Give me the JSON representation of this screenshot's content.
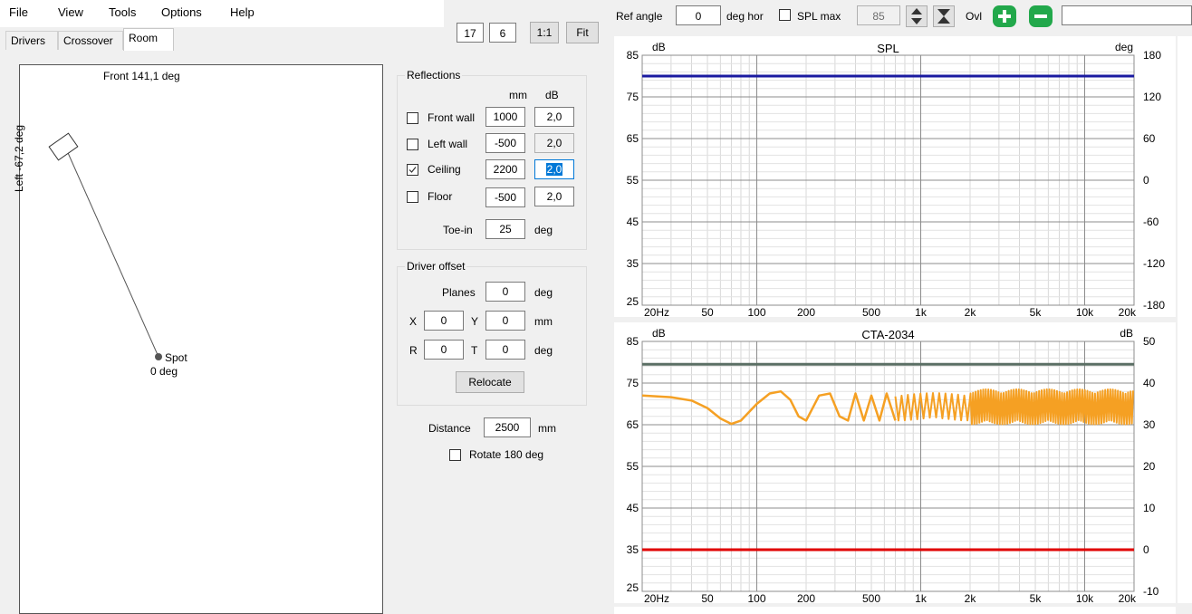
{
  "menu": [
    "File",
    "View",
    "Tools",
    "Options",
    "Help"
  ],
  "tabs": [
    "Drivers",
    "Crossover",
    "Room"
  ],
  "toolbar_left": {
    "n1": "17",
    "n2": "6",
    "one_to_one": "1:1",
    "fit": "Fit"
  },
  "toolbar_right": {
    "ref_angle_label": "Ref angle",
    "ref_angle_value": "0",
    "deg_hor_label": "deg hor",
    "spl_max_label": "SPL max",
    "spl_max_value": "85",
    "ovl_label": "Ovl",
    "ovl_value": ""
  },
  "room": {
    "front_label": "Front 141,1 deg",
    "left_label": "Left -67,2 deg",
    "spot_label": "Spot",
    "spot_deg": "0 deg"
  },
  "reflections": {
    "title": "Reflections",
    "col_mm": "mm",
    "col_db": "dB",
    "rows": [
      {
        "label": "Front wall",
        "checked": false,
        "mm": "1000",
        "db": "2,0"
      },
      {
        "label": "Left wall",
        "checked": false,
        "mm": "-500",
        "db": "2,0"
      },
      {
        "label": "Ceiling",
        "checked": true,
        "mm": "2200",
        "db": "2,0"
      },
      {
        "label": "Floor",
        "checked": false,
        "mm": "-500",
        "db": "2,0"
      }
    ],
    "toein_label": "Toe-in",
    "toein_value": "25",
    "toein_unit": "deg"
  },
  "driver_offset": {
    "title": "Driver offset",
    "planes_label": "Planes",
    "planes_value": "0",
    "planes_unit": "deg",
    "x_label": "X",
    "x_value": "0",
    "y_label": "Y",
    "y_value": "0",
    "xy_unit": "mm",
    "r_label": "R",
    "r_value": "0",
    "t_label": "T",
    "t_value": "0",
    "rt_unit": "deg",
    "relocate": "Relocate"
  },
  "distance": {
    "label": "Distance",
    "value": "2500",
    "unit": "mm",
    "rotate_label": "Rotate 180 deg"
  },
  "colors": {
    "blue_line": "#1a1aa0",
    "gray_line": "#5a6e64",
    "red_line": "#e00000",
    "orange_curve": "#f5a023"
  },
  "chart_data": [
    {
      "type": "line",
      "title": "SPL",
      "left_unit": "dB",
      "right_unit": "deg",
      "yticks": [
        "85",
        "75",
        "65",
        "55",
        "45",
        "35",
        "25"
      ],
      "rticks": [
        "180",
        "120",
        "60",
        "0",
        "-60",
        "-120",
        "-180"
      ],
      "xticks": [
        "20Hz",
        "50",
        "100",
        "200",
        "500",
        "1k",
        "2k",
        "5k",
        "10k",
        "20k"
      ],
      "ylim": [
        25,
        85
      ],
      "xlim": [
        20,
        20000
      ],
      "x_scale": "log",
      "grid": true,
      "series": [
        {
          "x": [
            20,
            20000
          ],
          "y": [
            80,
            80
          ]
        }
      ]
    },
    {
      "type": "line",
      "title": "CTA-2034",
      "left_unit": "dB",
      "right_unit": "dB",
      "yticks": [
        "85",
        "75",
        "65",
        "55",
        "45",
        "35",
        "25"
      ],
      "rticks": [
        "50",
        "40",
        "30",
        "20",
        "10",
        "0",
        "-10"
      ],
      "xticks": [
        "20Hz",
        "50",
        "100",
        "200",
        "500",
        "1k",
        "2k",
        "5k",
        "10k",
        "20k"
      ],
      "ylim": [
        25,
        85
      ],
      "xlim": [
        20,
        20000
      ],
      "x_scale": "log",
      "grid": true,
      "series": [
        {
          "x": [
            20,
            20000
          ],
          "y": [
            79.5,
            79.5
          ]
        },
        {
          "x": [
            20,
            20000
          ],
          "y": [
            35,
            35
          ]
        },
        {
          "x": [
            20,
            30,
            40,
            50,
            60,
            70,
            80,
            100,
            120,
            140,
            160,
            180,
            200,
            240,
            280,
            320,
            360,
            400,
            450,
            500,
            560,
            620,
            700
          ],
          "y": [
            72,
            71.6,
            70.8,
            69,
            66.5,
            65.2,
            66,
            70,
            72.5,
            73,
            71,
            67,
            66,
            72,
            72.5,
            67,
            66,
            72.5,
            66,
            72,
            66,
            72.5,
            66
          ]
        }
      ]
    }
  ]
}
